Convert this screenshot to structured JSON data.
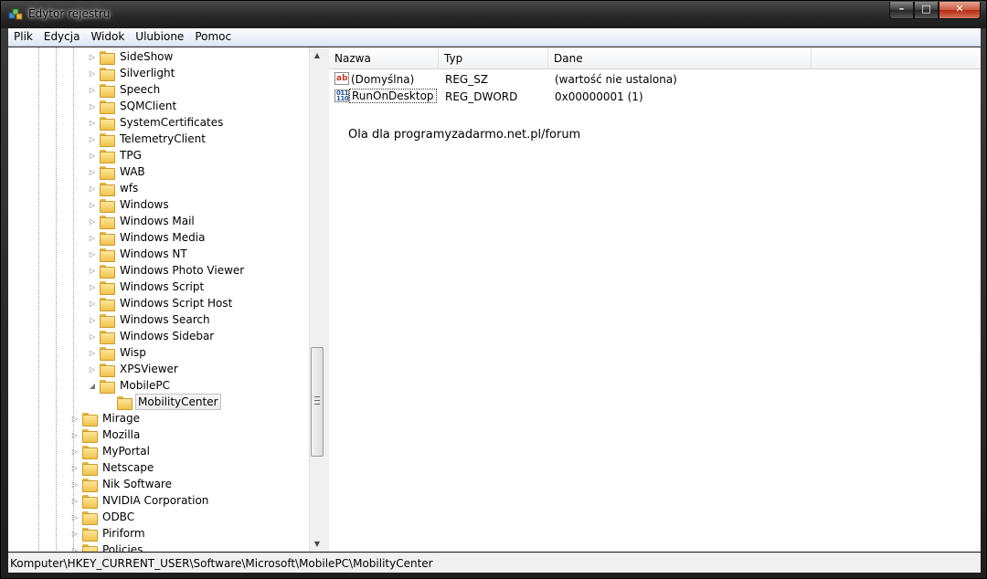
{
  "window": {
    "title": "Edytor rejestru",
    "buttons": {
      "minimize": "–",
      "maximize": "□",
      "close": "✕"
    }
  },
  "menu": [
    {
      "label": "Plik"
    },
    {
      "label": "Edycja"
    },
    {
      "label": "Widok"
    },
    {
      "label": "Ulubione"
    },
    {
      "label": "Pomoc"
    }
  ],
  "tree": {
    "items": [
      {
        "label": "SideShow",
        "level": 2,
        "expander": "▷"
      },
      {
        "label": "Silverlight",
        "level": 2,
        "expander": "▷"
      },
      {
        "label": "Speech",
        "level": 2,
        "expander": "▷"
      },
      {
        "label": "SQMClient",
        "level": 2,
        "expander": "▷"
      },
      {
        "label": "SystemCertificates",
        "level": 2,
        "expander": "▷"
      },
      {
        "label": "TelemetryClient",
        "level": 2,
        "expander": "▷"
      },
      {
        "label": "TPG",
        "level": 2,
        "expander": "▷"
      },
      {
        "label": "WAB",
        "level": 2,
        "expander": "▷"
      },
      {
        "label": "wfs",
        "level": 2,
        "expander": "▷"
      },
      {
        "label": "Windows",
        "level": 2,
        "expander": "▷"
      },
      {
        "label": "Windows Mail",
        "level": 2,
        "expander": "▷"
      },
      {
        "label": "Windows Media",
        "level": 2,
        "expander": "▷"
      },
      {
        "label": "Windows NT",
        "level": 2,
        "expander": "▷"
      },
      {
        "label": "Windows Photo Viewer",
        "level": 2,
        "expander": "▷"
      },
      {
        "label": "Windows Script",
        "level": 2,
        "expander": "▷"
      },
      {
        "label": "Windows Script Host",
        "level": 2,
        "expander": "▷"
      },
      {
        "label": "Windows Search",
        "level": 2,
        "expander": "▷"
      },
      {
        "label": "Windows Sidebar",
        "level": 2,
        "expander": "▷"
      },
      {
        "label": "Wisp",
        "level": 2,
        "expander": "▷"
      },
      {
        "label": "XPSViewer",
        "level": 2,
        "expander": "▷"
      },
      {
        "label": "MobilePC",
        "level": 2,
        "expander": "◢"
      },
      {
        "label": "MobilityCenter",
        "level": 3,
        "expander": "",
        "selected": true
      },
      {
        "label": "Mirage",
        "level": 1,
        "expander": "▷"
      },
      {
        "label": "Mozilla",
        "level": 1,
        "expander": "▷"
      },
      {
        "label": "MyPortal",
        "level": 1,
        "expander": "▷"
      },
      {
        "label": "Netscape",
        "level": 1,
        "expander": "▷"
      },
      {
        "label": "Nik Software",
        "level": 1,
        "expander": "▷"
      },
      {
        "label": "NVIDIA Corporation",
        "level": 1,
        "expander": "▷"
      },
      {
        "label": "ODBC",
        "level": 1,
        "expander": "▷"
      },
      {
        "label": "Piriform",
        "level": 1,
        "expander": "▷"
      },
      {
        "label": "Policies",
        "level": 1,
        "expander": "▷"
      }
    ],
    "scroll_up": "▲",
    "scroll_down": "▼"
  },
  "list": {
    "columns": [
      "Nazwa",
      "Typ",
      "Dane"
    ],
    "rows": [
      {
        "name": "(Domyślna)",
        "type": "REG_SZ",
        "data": "(wartość nie ustalona)",
        "icon": "string-value-icon",
        "icon_text": "ab"
      },
      {
        "name": "RunOnDesktop",
        "type": "REG_DWORD",
        "data": "0x00000001 (1)",
        "icon": "binary-value-icon",
        "icon_text": "011\n110"
      }
    ],
    "note": "Ola dla programyzadarmo.net.pl/forum"
  },
  "status": {
    "path": "Komputer\\HKEY_CURRENT_USER\\Software\\Microsoft\\MobilePC\\MobilityCenter"
  }
}
